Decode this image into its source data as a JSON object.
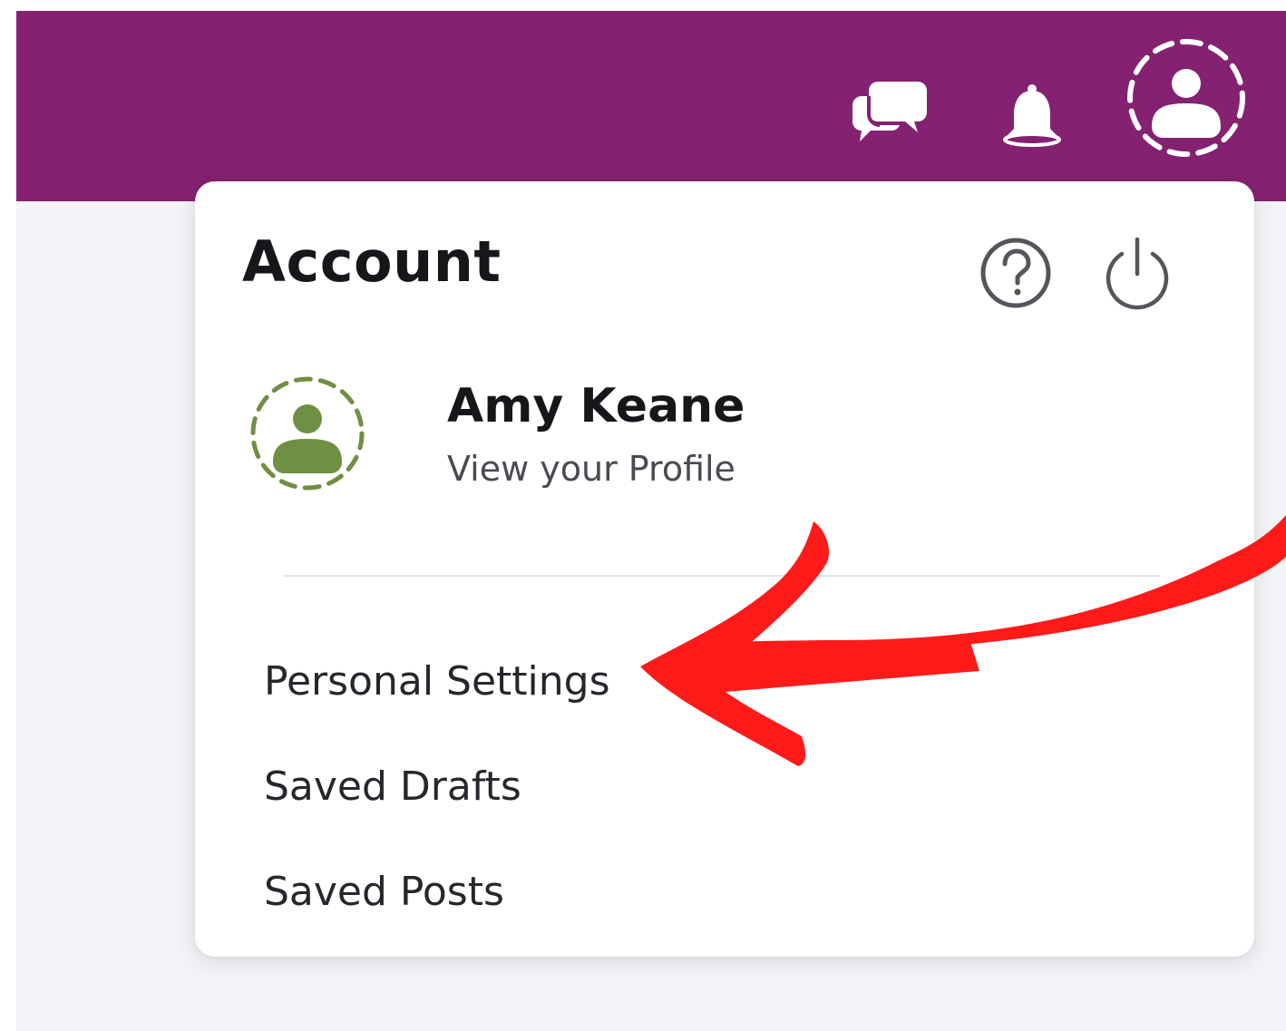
{
  "header": {
    "background": "#842171",
    "icons": [
      "chat-bubbles-icon",
      "bell-icon",
      "user-avatar-icon"
    ]
  },
  "account_panel": {
    "title": "Account",
    "icons": [
      "help-icon",
      "power-icon"
    ],
    "user": {
      "name": "Amy Keane",
      "profile_link": "View your Profile",
      "avatar_color": "#6f8f43"
    },
    "menu_items": [
      {
        "label": "Personal Settings"
      },
      {
        "label": "Saved Drafts"
      },
      {
        "label": "Saved Posts"
      }
    ]
  },
  "annotation": {
    "arrow_icon": "red-arrow-icon",
    "color": "#ff1a1a",
    "target": "Personal Settings"
  }
}
